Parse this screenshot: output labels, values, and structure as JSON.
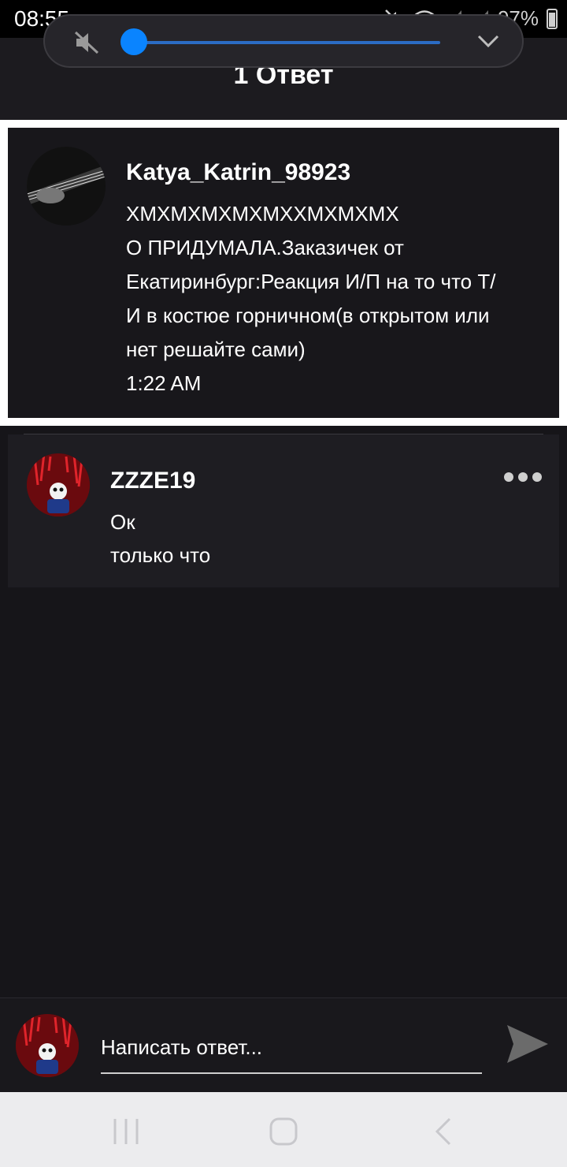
{
  "status_bar": {
    "time": "08:55",
    "battery": "97%",
    "icons": [
      "mute-icon",
      "wifi-icon",
      "signal-icon",
      "signal-icon",
      "battery-icon"
    ]
  },
  "volume_panel": {
    "level_fraction": 0.02,
    "icons": [
      "volume-mute-icon",
      "chevron-down-icon"
    ],
    "accent_color": "#0a84ff"
  },
  "header": {
    "title": "1 Ответ"
  },
  "post": {
    "author": "Katya_Katrin_98923",
    "lines": [
      "ХМХМХМХМХМХХМХМХМХ",
      "О ПРИДУМАЛА.Заказичек от",
      "Екатиринбург:Реакция И/П на то что Т/",
      "И в костюе горничном(в открытом или",
      "нет решайте сами)"
    ],
    "time": "1:22 AM"
  },
  "replies": [
    {
      "author": "ZZZE19",
      "text": "Ок",
      "time": "только что"
    }
  ],
  "composer": {
    "placeholder": "Написать ответ..."
  },
  "nav": {
    "icons": [
      "recent-apps-icon",
      "home-icon",
      "back-icon"
    ]
  }
}
